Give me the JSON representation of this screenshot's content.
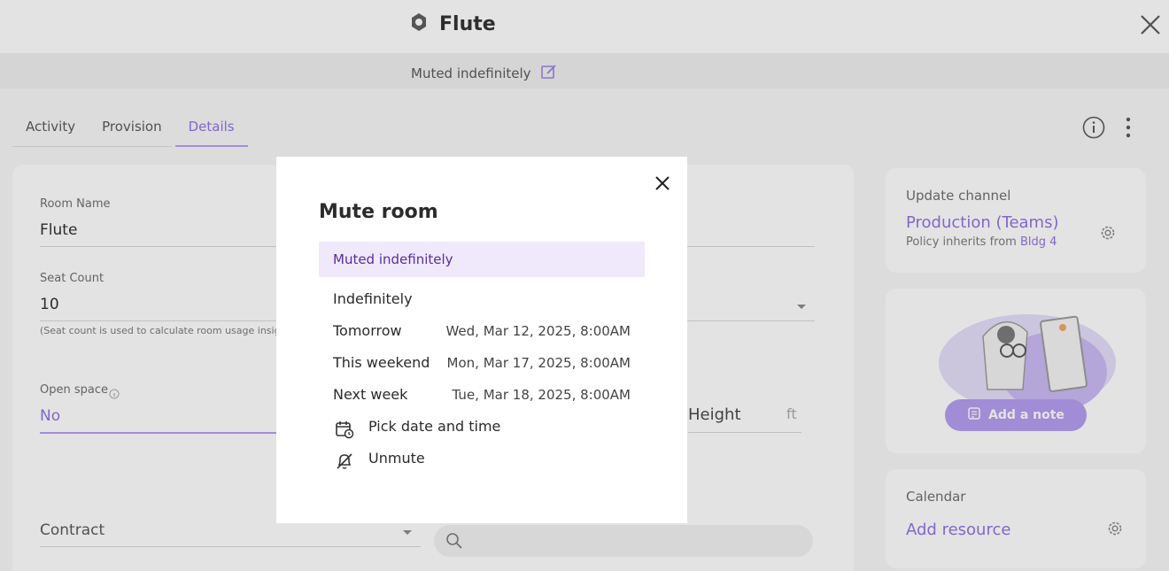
{
  "header": {
    "title": "Flute",
    "status": "Muted indefinitely"
  },
  "tabs": [
    {
      "label": "Activity"
    },
    {
      "label": "Provision"
    },
    {
      "label": "Details"
    }
  ],
  "details": {
    "room_name_label": "Room Name",
    "room_name_value": "Flute",
    "seat_count_label": "Seat Count",
    "seat_count_value": "10",
    "seat_count_help": "(Seat count is used to calculate room usage insights",
    "open_space_label": "Open space",
    "open_space_value": "No",
    "contract_label": "Contract",
    "height_label": "Height",
    "height_unit": "ft"
  },
  "update_channel": {
    "label": "Update channel",
    "value": "Production (Teams)",
    "inherit_prefix": "Policy inherits from",
    "inherit_link": "Bldg 4"
  },
  "note": {
    "button_label": "Add a note"
  },
  "calendar": {
    "label": "Calendar",
    "link": "Add resource"
  },
  "modal": {
    "title": "Mute room",
    "selected": "Muted indefinitely",
    "options": [
      {
        "label": "Indefinitely",
        "date": ""
      },
      {
        "label": "Tomorrow",
        "date": "Wed, Mar 12, 2025, 8:00AM"
      },
      {
        "label": "This weekend",
        "date": "Mon, Mar 17, 2025, 8:00AM"
      },
      {
        "label": "Next week",
        "date": "Tue, Mar 18, 2025, 8:00AM"
      }
    ],
    "pick_label": "Pick date and time",
    "unmute_label": "Unmute"
  },
  "colors": {
    "accent": "#8f6fe0",
    "selected_bg": "#efe9fb",
    "selected_text": "#5b2d9e"
  }
}
